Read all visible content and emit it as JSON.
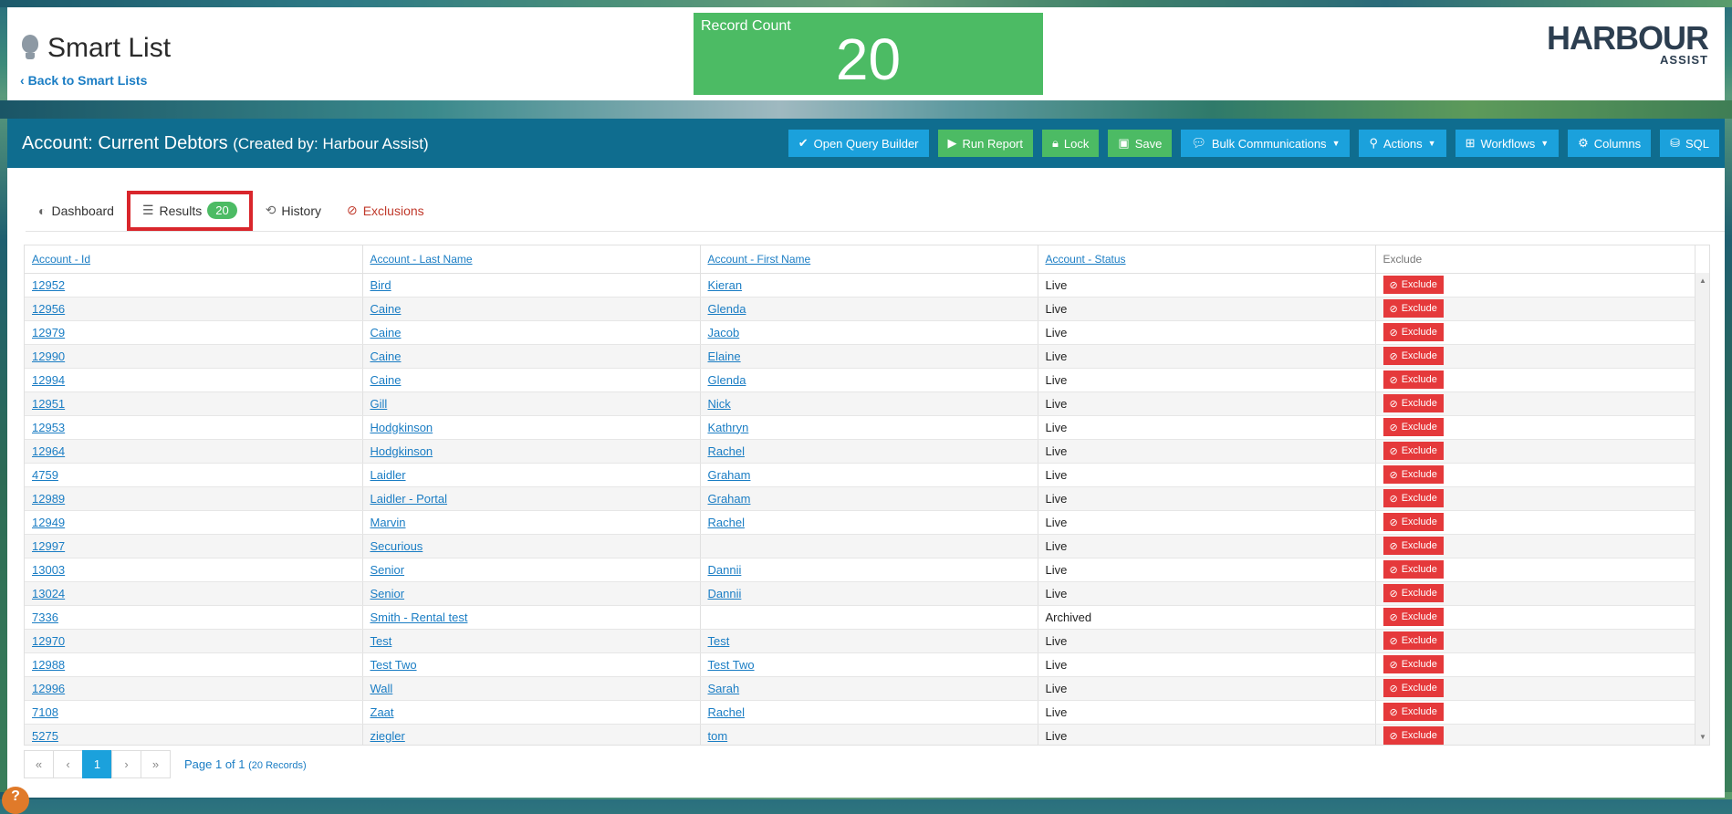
{
  "header": {
    "page_title": "Smart List",
    "back_link": "Back to Smart Lists",
    "record_count_label": "Record Count",
    "record_count_value": "20",
    "logo_main": "HARBOUR",
    "logo_sub": "ASSIST"
  },
  "panel": {
    "title": "Account: Current Debtors",
    "subtitle": "(Created by: Harbour Assist)"
  },
  "toolbar": {
    "open_query_builder": "Open Query Builder",
    "run_report": "Run Report",
    "lock": "Lock",
    "save": "Save",
    "bulk_communications": "Bulk Communications",
    "actions": "Actions",
    "workflows": "Workflows",
    "columns": "Columns",
    "sql": "SQL"
  },
  "tabs": {
    "dashboard": "Dashboard",
    "results": "Results",
    "results_count": "20",
    "history": "History",
    "exclusions": "Exclusions"
  },
  "table": {
    "headers": [
      "Account - Id",
      "Account - Last Name",
      "Account - First Name",
      "Account - Status",
      "Exclude"
    ],
    "exclude_label": "Exclude",
    "rows": [
      {
        "id": "12952",
        "last": "Bird",
        "first": "Kieran",
        "status": "Live"
      },
      {
        "id": "12956",
        "last": "Caine",
        "first": "Glenda",
        "status": "Live"
      },
      {
        "id": "12979",
        "last": "Caine",
        "first": "Jacob",
        "status": "Live"
      },
      {
        "id": "12990",
        "last": "Caine",
        "first": "Elaine",
        "status": "Live"
      },
      {
        "id": "12994",
        "last": "Caine",
        "first": "Glenda",
        "status": "Live"
      },
      {
        "id": "12951",
        "last": "Gill",
        "first": "Nick",
        "status": "Live"
      },
      {
        "id": "12953",
        "last": "Hodgkinson",
        "first": "Kathryn",
        "status": "Live"
      },
      {
        "id": "12964",
        "last": "Hodgkinson",
        "first": "Rachel",
        "status": "Live"
      },
      {
        "id": "4759",
        "last": "Laidler",
        "first": "Graham",
        "status": "Live"
      },
      {
        "id": "12989",
        "last": "Laidler - Portal",
        "first": "Graham",
        "status": "Live"
      },
      {
        "id": "12949",
        "last": "Marvin",
        "first": "Rachel",
        "status": "Live"
      },
      {
        "id": "12997",
        "last": "Securious",
        "first": "",
        "status": "Live"
      },
      {
        "id": "13003",
        "last": "Senior",
        "first": "Dannii",
        "status": "Live"
      },
      {
        "id": "13024",
        "last": "Senior",
        "first": "Dannii",
        "status": "Live"
      },
      {
        "id": "7336",
        "last": "Smith - Rental test",
        "first": "",
        "status": "Archived"
      },
      {
        "id": "12970",
        "last": "Test",
        "first": "Test",
        "status": "Live"
      },
      {
        "id": "12988",
        "last": "Test Two",
        "first": "Test Two",
        "status": "Live"
      },
      {
        "id": "12996",
        "last": "Wall",
        "first": "Sarah",
        "status": "Live"
      },
      {
        "id": "7108",
        "last": "Zaat",
        "first": "Rachel",
        "status": "Live"
      },
      {
        "id": "5275",
        "last": "ziegler",
        "first": "tom",
        "status": "Live"
      }
    ]
  },
  "pagination": {
    "first": "«",
    "prev": "‹",
    "current": "1",
    "next": "›",
    "last": "»",
    "page_text": "Page 1 of 1",
    "records_text": "(20 Records)"
  },
  "help": {
    "label": "?"
  },
  "colors": {
    "primary_blue": "#1ba1dc",
    "header_teal": "#0f6d8f",
    "success_green": "#4cbb64",
    "danger_red": "#e5393b"
  }
}
